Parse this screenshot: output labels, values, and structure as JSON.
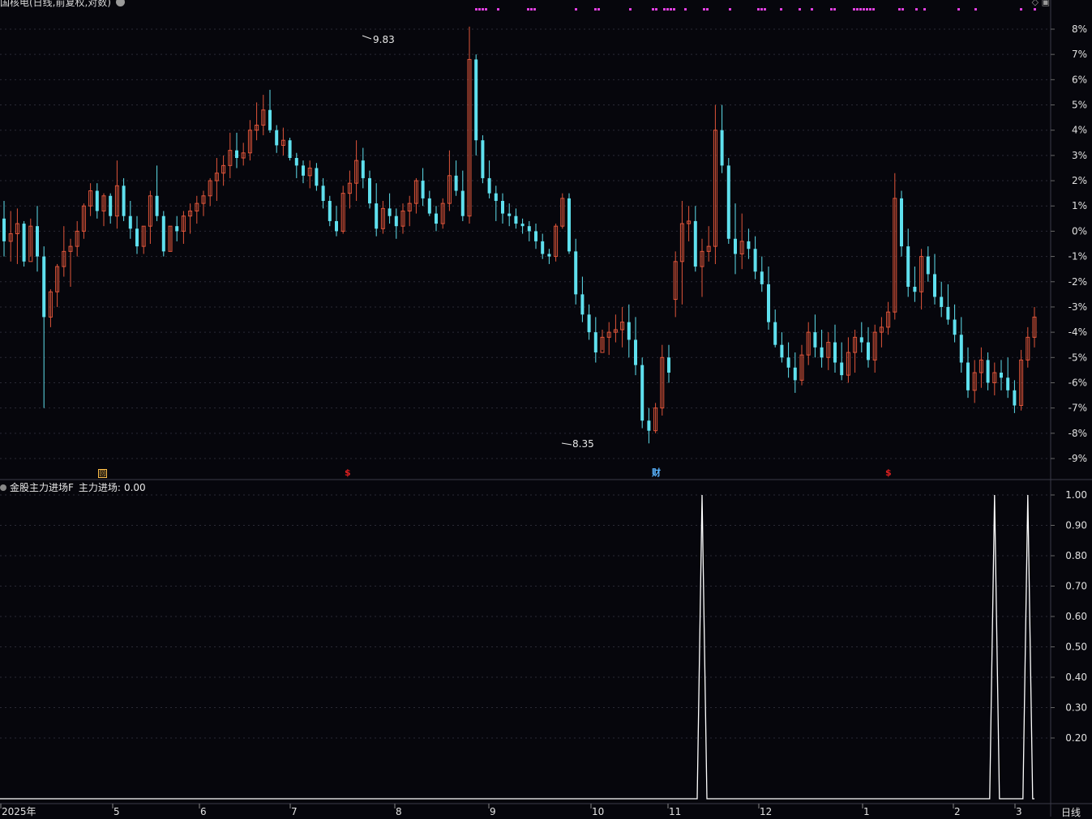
{
  "window": {
    "main_title": "国核电(日线,前复权,对数)",
    "gear_icon": "gear-icon"
  },
  "indicator": {
    "name": "金股主力进场F",
    "value_label": "主力进场:",
    "value": "0.00"
  },
  "period_label": "日线",
  "colors": {
    "background": "#06060c",
    "up": "#e0553a",
    "down": "#5fe0ee",
    "grid": "#2a2a36",
    "axis_text": "#e0e0e0",
    "signal_dots": "#e040e0",
    "indicator_line": "#ffffff"
  },
  "y_axis_main": [
    "8%",
    "7%",
    "6%",
    "5%",
    "4%",
    "3%",
    "2%",
    "1%",
    "0%",
    "-1%",
    "-2%",
    "-3%",
    "-4%",
    "-5%",
    "-6%",
    "-7%",
    "-8%",
    "-9%"
  ],
  "y_axis_indicator": [
    "1.00",
    "0.90",
    "0.80",
    "0.70",
    "0.60",
    "0.50",
    "0.40",
    "0.30",
    "0.20"
  ],
  "x_axis": [
    "2025年",
    "5",
    "6",
    "7",
    "8",
    "9",
    "10",
    "11",
    "12",
    "1",
    "2",
    "3"
  ],
  "annotations": {
    "high": "9.83",
    "low": "8.35"
  },
  "event_markers": [
    {
      "type": "box",
      "glyph": "回"
    },
    {
      "type": "dollar",
      "glyph": "$"
    },
    {
      "type": "cai",
      "glyph": "财"
    },
    {
      "type": "dollar",
      "glyph": "$"
    }
  ],
  "chart_data": [
    {
      "type": "candlestick",
      "title": "国核电(日线,前复权,对数)",
      "y_unit": "%",
      "ylim": [
        -9.5,
        8.5
      ],
      "high_label": 9.83,
      "low_label": 8.35,
      "grid": true,
      "candles_pct_ohlc": [
        [
          0.5,
          1.2,
          -1.0,
          -0.4
        ],
        [
          -0.4,
          0.8,
          -1.2,
          -0.1
        ],
        [
          -0.1,
          0.9,
          -1.3,
          0.3
        ],
        [
          0.3,
          0.4,
          -1.4,
          -1.2
        ],
        [
          -1.2,
          0.5,
          -1.0,
          0.2
        ],
        [
          0.2,
          1.0,
          -1.6,
          -1.0
        ],
        [
          -1.0,
          -0.6,
          -7.0,
          -3.4
        ],
        [
          -3.4,
          -2.3,
          -3.8,
          -2.4
        ],
        [
          -2.4,
          -1.3,
          -3.0,
          -1.4
        ],
        [
          -1.4,
          0.2,
          -1.8,
          -0.8
        ],
        [
          -0.8,
          -0.3,
          -2.2,
          -0.6
        ],
        [
          -0.6,
          0.4,
          -1.0,
          0.0
        ],
        [
          0.0,
          1.1,
          -0.3,
          1.0
        ],
        [
          1.0,
          1.9,
          0.6,
          1.6
        ],
        [
          1.6,
          1.9,
          0.5,
          0.8
        ],
        [
          0.8,
          1.5,
          0.2,
          1.4
        ],
        [
          1.4,
          1.5,
          0.3,
          0.6
        ],
        [
          0.6,
          2.8,
          0.1,
          1.8
        ],
        [
          1.8,
          2.1,
          0.4,
          0.6
        ],
        [
          0.6,
          1.2,
          -0.3,
          0.1
        ],
        [
          0.1,
          0.6,
          -0.9,
          -0.6
        ],
        [
          -0.6,
          0.2,
          -0.9,
          0.2
        ],
        [
          0.2,
          1.6,
          -0.5,
          1.4
        ],
        [
          1.4,
          2.6,
          0.4,
          0.6
        ],
        [
          0.6,
          0.8,
          -1.0,
          -0.8
        ],
        [
          -0.8,
          0.2,
          -0.8,
          0.2
        ],
        [
          0.2,
          0.6,
          -0.4,
          0.0
        ],
        [
          0.0,
          0.8,
          -0.5,
          0.6
        ],
        [
          0.6,
          1.1,
          -0.1,
          0.8
        ],
        [
          0.8,
          1.4,
          0.3,
          1.1
        ],
        [
          1.1,
          1.6,
          0.6,
          1.4
        ],
        [
          1.4,
          2.1,
          1.0,
          2.0
        ],
        [
          2.0,
          2.9,
          1.2,
          2.3
        ],
        [
          2.3,
          3.0,
          1.8,
          2.6
        ],
        [
          2.6,
          3.9,
          2.1,
          3.2
        ],
        [
          3.2,
          3.9,
          2.5,
          2.9
        ],
        [
          2.9,
          3.5,
          2.6,
          3.1
        ],
        [
          3.1,
          4.4,
          2.8,
          4.0
        ],
        [
          4.0,
          5.1,
          3.6,
          4.2
        ],
        [
          4.2,
          5.4,
          3.8,
          4.8
        ],
        [
          4.8,
          5.6,
          3.9,
          4.0
        ],
        [
          4.0,
          4.2,
          3.1,
          3.4
        ],
        [
          3.4,
          4.1,
          3.0,
          3.6
        ],
        [
          3.6,
          3.7,
          2.8,
          2.9
        ],
        [
          2.9,
          3.1,
          2.1,
          2.6
        ],
        [
          2.6,
          2.8,
          1.9,
          2.2
        ],
        [
          2.2,
          2.8,
          1.7,
          2.5
        ],
        [
          2.5,
          2.7,
          1.6,
          1.8
        ],
        [
          1.8,
          2.1,
          0.9,
          1.2
        ],
        [
          1.2,
          1.4,
          0.2,
          0.4
        ],
        [
          0.4,
          1.0,
          -0.2,
          0.0
        ],
        [
          0.0,
          1.8,
          -0.1,
          1.5
        ],
        [
          1.5,
          2.4,
          0.9,
          1.9
        ],
        [
          1.9,
          3.6,
          1.2,
          2.8
        ],
        [
          2.8,
          3.3,
          1.7,
          2.1
        ],
        [
          2.1,
          2.4,
          0.9,
          1.1
        ],
        [
          1.1,
          1.9,
          -0.2,
          0.1
        ],
        [
          0.1,
          1.2,
          -0.1,
          0.9
        ],
        [
          0.9,
          1.5,
          0.3,
          0.6
        ],
        [
          0.6,
          0.9,
          -0.3,
          0.2
        ],
        [
          0.2,
          1.1,
          -0.1,
          0.8
        ],
        [
          0.8,
          1.4,
          0.2,
          1.1
        ],
        [
          1.1,
          2.1,
          0.7,
          2.0
        ],
        [
          2.0,
          2.5,
          1.0,
          1.3
        ],
        [
          1.3,
          1.6,
          0.6,
          0.7
        ],
        [
          0.7,
          1.0,
          0.0,
          0.3
        ],
        [
          0.3,
          1.3,
          0.1,
          1.1
        ],
        [
          1.1,
          3.2,
          0.8,
          2.2
        ],
        [
          2.2,
          2.8,
          1.4,
          1.6
        ],
        [
          1.6,
          2.4,
          0.4,
          0.6
        ],
        [
          0.6,
          8.1,
          0.3,
          6.8
        ],
        [
          6.8,
          7.0,
          3.0,
          3.6
        ],
        [
          3.6,
          3.8,
          1.9,
          2.1
        ],
        [
          2.1,
          2.8,
          1.3,
          1.5
        ],
        [
          1.5,
          1.8,
          0.4,
          1.2
        ],
        [
          1.2,
          1.5,
          0.3,
          0.7
        ],
        [
          0.7,
          1.1,
          0.2,
          0.6
        ],
        [
          0.6,
          0.9,
          0.1,
          0.3
        ],
        [
          0.3,
          0.5,
          -0.1,
          0.2
        ],
        [
          0.2,
          0.4,
          -0.4,
          0.0
        ],
        [
          0.0,
          0.3,
          -0.7,
          -0.4
        ],
        [
          -0.4,
          -0.1,
          -1.1,
          -0.9
        ],
        [
          -0.9,
          -0.7,
          -1.3,
          -1.0
        ],
        [
          -1.0,
          0.3,
          -1.2,
          0.2
        ],
        [
          0.2,
          1.5,
          0.1,
          1.3
        ],
        [
          1.3,
          1.5,
          -0.9,
          -0.8
        ],
        [
          -0.8,
          -0.3,
          -2.9,
          -2.5
        ],
        [
          -2.5,
          -1.8,
          -3.6,
          -3.3
        ],
        [
          -3.3,
          -2.9,
          -4.3,
          -4.0
        ],
        [
          -4.0,
          -3.4,
          -5.2,
          -4.8
        ],
        [
          -4.8,
          -3.9,
          -4.7,
          -4.2
        ],
        [
          -4.2,
          -3.6,
          -4.9,
          -4.0
        ],
        [
          -4.0,
          -3.3,
          -4.4,
          -3.9
        ],
        [
          -3.9,
          -3.0,
          -4.6,
          -3.6
        ],
        [
          -3.6,
          -2.9,
          -5.0,
          -4.3
        ],
        [
          -4.3,
          -3.4,
          -5.7,
          -5.3
        ],
        [
          -5.3,
          -5.0,
          -7.8,
          -7.5
        ],
        [
          -7.5,
          -7.0,
          -8.4,
          -7.9
        ],
        [
          -7.9,
          -6.8,
          -8.0,
          -7.0
        ],
        [
          -7.0,
          -4.5,
          -7.3,
          -5.0
        ],
        [
          -5.0,
          -4.5,
          -6.0,
          -5.6
        ],
        [
          -2.7,
          -0.8,
          -3.4,
          -1.2
        ],
        [
          -1.2,
          1.2,
          -2.9,
          0.3
        ],
        [
          0.3,
          1.0,
          -0.4,
          0.4
        ],
        [
          0.4,
          1.0,
          -1.6,
          -1.4
        ],
        [
          -1.4,
          -0.3,
          -2.6,
          -0.8
        ],
        [
          -0.8,
          0.2,
          -1.2,
          -0.6
        ],
        [
          -0.6,
          5.0,
          -1.3,
          4.0
        ],
        [
          4.0,
          5.0,
          2.3,
          2.6
        ],
        [
          2.6,
          2.9,
          -0.5,
          -0.3
        ],
        [
          -0.3,
          1.1,
          -1.7,
          -0.9
        ],
        [
          -0.9,
          0.7,
          -1.5,
          -0.4
        ],
        [
          -0.4,
          0.1,
          -1.1,
          -0.7
        ],
        [
          -0.7,
          -0.2,
          -1.9,
          -1.6
        ],
        [
          -1.6,
          -1.0,
          -2.4,
          -2.1
        ],
        [
          -2.1,
          -1.4,
          -3.9,
          -3.6
        ],
        [
          -3.6,
          -3.1,
          -4.6,
          -4.5
        ],
        [
          -4.5,
          -4.0,
          -5.2,
          -5.0
        ],
        [
          -5.0,
          -4.4,
          -5.8,
          -5.4
        ],
        [
          -5.4,
          -4.8,
          -6.4,
          -5.9
        ],
        [
          -5.9,
          -4.5,
          -6.1,
          -4.9
        ],
        [
          -4.9,
          -3.6,
          -5.3,
          -4.0
        ],
        [
          -4.0,
          -3.3,
          -5.0,
          -4.6
        ],
        [
          -4.6,
          -3.9,
          -5.4,
          -5.0
        ],
        [
          -5.0,
          -4.0,
          -5.5,
          -4.4
        ],
        [
          -4.4,
          -3.7,
          -5.6,
          -5.2
        ],
        [
          -5.2,
          -4.4,
          -5.9,
          -5.7
        ],
        [
          -5.7,
          -4.2,
          -6.0,
          -4.8
        ],
        [
          -4.8,
          -3.9,
          -5.6,
          -4.2
        ],
        [
          -4.2,
          -3.6,
          -4.8,
          -4.4
        ],
        [
          -4.4,
          -3.8,
          -5.4,
          -5.1
        ],
        [
          -5.1,
          -3.7,
          -5.6,
          -4.0
        ],
        [
          -4.0,
          -3.4,
          -4.6,
          -3.8
        ],
        [
          -3.8,
          -2.8,
          -4.1,
          -3.2
        ],
        [
          -3.2,
          2.3,
          -3.5,
          1.3
        ],
        [
          1.3,
          1.6,
          -1.0,
          -0.6
        ],
        [
          -0.6,
          0.1,
          -2.6,
          -2.2
        ],
        [
          -2.2,
          -1.4,
          -2.8,
          -2.4
        ],
        [
          -2.4,
          -0.7,
          -3.1,
          -1.0
        ],
        [
          -1.0,
          -0.6,
          -2.0,
          -1.7
        ],
        [
          -1.7,
          -0.9,
          -2.9,
          -2.6
        ],
        [
          -2.6,
          -2.0,
          -3.4,
          -3.0
        ],
        [
          -3.0,
          -2.1,
          -3.7,
          -3.5
        ],
        [
          -3.5,
          -2.9,
          -4.4,
          -4.1
        ],
        [
          -4.1,
          -3.4,
          -5.6,
          -5.2
        ],
        [
          -5.2,
          -4.6,
          -6.6,
          -6.3
        ],
        [
          -6.3,
          -5.1,
          -6.8,
          -5.6
        ],
        [
          -5.6,
          -4.6,
          -6.2,
          -5.1
        ],
        [
          -5.1,
          -4.8,
          -6.3,
          -6.0
        ],
        [
          -6.0,
          -5.2,
          -6.5,
          -5.6
        ],
        [
          -5.6,
          -5.1,
          -6.3,
          -5.8
        ],
        [
          -5.8,
          -5.0,
          -6.6,
          -6.3
        ],
        [
          -6.3,
          -5.9,
          -7.2,
          -6.9
        ],
        [
          -6.9,
          -4.7,
          -7.1,
          -5.1
        ],
        [
          -5.1,
          -3.8,
          -5.4,
          -4.2
        ],
        [
          -4.2,
          -3.0,
          -4.6,
          -3.4
        ]
      ]
    },
    {
      "type": "line",
      "title": "金股主力进场F",
      "series": [
        {
          "name": "主力进场",
          "spikes_at_index": [
            105,
            149,
            154
          ],
          "spike_value": 1.0,
          "base_value": 0.0
        }
      ],
      "ylim": [
        0,
        1.05
      ]
    }
  ]
}
